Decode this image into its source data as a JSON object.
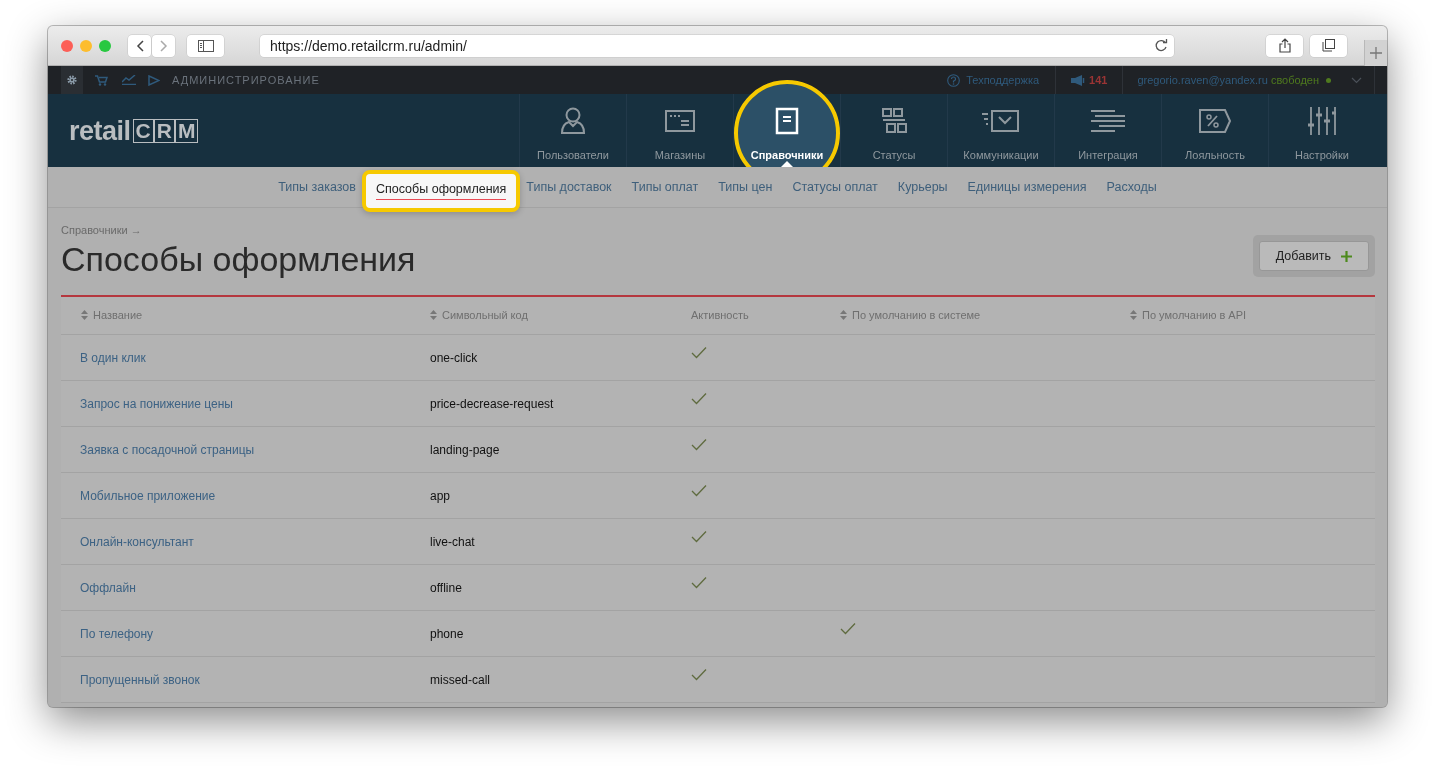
{
  "browser": {
    "url": "https://demo.retailcrm.ru/admin/"
  },
  "top_bar": {
    "section": "АДМИНИСТРИРОВАНИЕ",
    "support": "Техподдержка",
    "notifications": "141",
    "user": "gregorio.raven@yandex.ru",
    "status": "свободен"
  },
  "logo": {
    "text": "retail",
    "mark": "CRM"
  },
  "nav": {
    "items": [
      {
        "label": "Пользователи",
        "selected": false
      },
      {
        "label": "Магазины",
        "selected": false
      },
      {
        "label": "Справочники",
        "selected": true
      },
      {
        "label": "Статусы",
        "selected": false
      },
      {
        "label": "Коммуникации",
        "selected": false
      },
      {
        "label": "Интеграция",
        "selected": false
      },
      {
        "label": "Лояльность",
        "selected": false
      },
      {
        "label": "Настройки",
        "selected": false
      }
    ]
  },
  "subnav": {
    "items": [
      {
        "label": "Типы заказов",
        "selected": false
      },
      {
        "label": "Способы оформления",
        "selected": true
      },
      {
        "label": "Типы доставок",
        "selected": false
      },
      {
        "label": "Типы оплат",
        "selected": false
      },
      {
        "label": "Типы цен",
        "selected": false
      },
      {
        "label": "Статусы оплат",
        "selected": false
      },
      {
        "label": "Курьеры",
        "selected": false
      },
      {
        "label": "Единицы измерения",
        "selected": false
      },
      {
        "label": "Расходы",
        "selected": false
      }
    ]
  },
  "breadcrumb": "Справочники →",
  "title": "Способы оформления",
  "add_button": "Добавить",
  "table": {
    "columns": [
      {
        "label": "Название",
        "sortable": true
      },
      {
        "label": "Символьный код",
        "sortable": true
      },
      {
        "label": "Активность",
        "sortable": false
      },
      {
        "label": "По умолчанию в системе",
        "sortable": true
      },
      {
        "label": "По умолчанию в API",
        "sortable": true
      }
    ],
    "rows": [
      {
        "name": "В один клик",
        "code": "one-click",
        "active": true,
        "default_system": false,
        "default_api": false
      },
      {
        "name": "Запрос на понижение цены",
        "code": "price-decrease-request",
        "active": true,
        "default_system": false,
        "default_api": false
      },
      {
        "name": "Заявка с посадочной страницы",
        "code": "landing-page",
        "active": true,
        "default_system": false,
        "default_api": false
      },
      {
        "name": "Мобильное приложение",
        "code": "app",
        "active": true,
        "default_system": false,
        "default_api": false
      },
      {
        "name": "Онлайн-консультант",
        "code": "live-chat",
        "active": true,
        "default_system": false,
        "default_api": false
      },
      {
        "name": "Оффлайн",
        "code": "offline",
        "active": true,
        "default_system": false,
        "default_api": false
      },
      {
        "name": "По телефону",
        "code": "phone",
        "active": false,
        "default_system": true,
        "default_api": false
      },
      {
        "name": "Пропущенный звонок",
        "code": "missed-call",
        "active": true,
        "default_system": false,
        "default_api": false
      }
    ]
  }
}
